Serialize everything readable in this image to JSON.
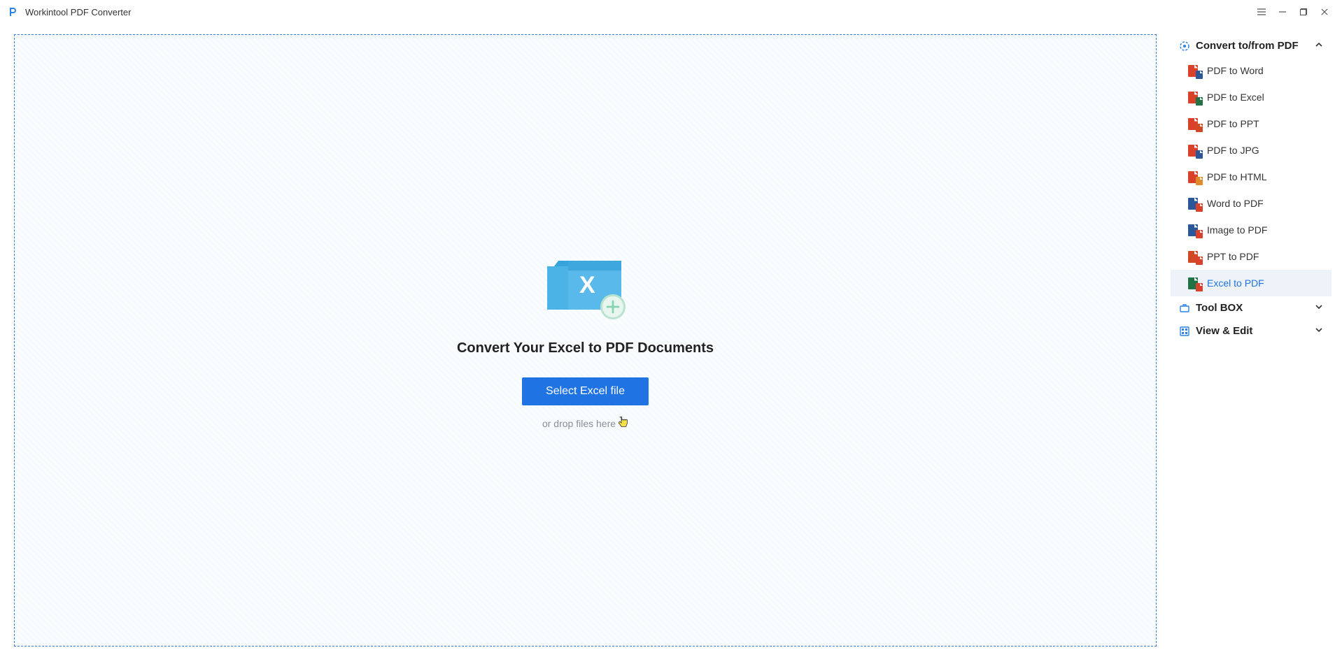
{
  "titlebar": {
    "app_name": "Workintool PDF Converter"
  },
  "main": {
    "heading": "Convert Your Excel to PDF Documents",
    "select_button": "Select Excel file",
    "drop_hint": "or drop files here"
  },
  "sidebar": {
    "sections": [
      {
        "id": "convert",
        "label": "Convert to/from PDF",
        "expanded": true,
        "items": [
          {
            "id": "pdf-to-word",
            "label": "PDF to Word",
            "c1": "#d9412a",
            "c2": "#2b579a"
          },
          {
            "id": "pdf-to-excel",
            "label": "PDF to Excel",
            "c1": "#d9412a",
            "c2": "#217346"
          },
          {
            "id": "pdf-to-ppt",
            "label": "PDF to PPT",
            "c1": "#d9412a",
            "c2": "#d24726"
          },
          {
            "id": "pdf-to-jpg",
            "label": "PDF to JPG",
            "c1": "#d9412a",
            "c2": "#2b579a"
          },
          {
            "id": "pdf-to-html",
            "label": "PDF to HTML",
            "c1": "#d9412a",
            "c2": "#e08a2a"
          },
          {
            "id": "word-to-pdf",
            "label": "Word to PDF",
            "c1": "#2b579a",
            "c2": "#d9412a"
          },
          {
            "id": "image-to-pdf",
            "label": "Image to PDF",
            "c1": "#2b579a",
            "c2": "#d9412a"
          },
          {
            "id": "ppt-to-pdf",
            "label": "PPT to PDF",
            "c1": "#d24726",
            "c2": "#d9412a"
          },
          {
            "id": "excel-to-pdf",
            "label": "Excel to PDF",
            "c1": "#217346",
            "c2": "#d9412a",
            "active": true
          }
        ]
      },
      {
        "id": "toolbox",
        "label": "Tool BOX",
        "expanded": false
      },
      {
        "id": "view-edit",
        "label": "View & Edit",
        "expanded": false
      }
    ]
  }
}
